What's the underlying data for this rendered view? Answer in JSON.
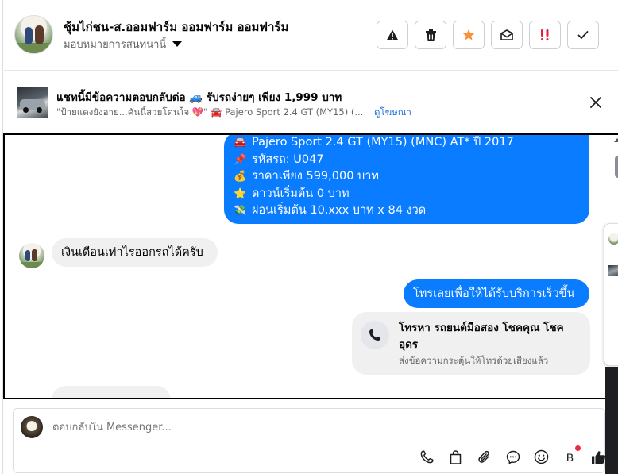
{
  "header": {
    "title": "ชุ้มไก่ชน-ส.ออมฟาร์ม ออมฟาร์ม ออมฟาร์ม",
    "assign_label": "มอบหมายการสนทนานี้",
    "buttons": [
      {
        "icon": "warning-icon"
      },
      {
        "icon": "trash-icon"
      },
      {
        "icon": "star-icon",
        "color": "#f7913d"
      },
      {
        "icon": "mark-unread-icon"
      },
      {
        "icon": "follow-up-icon",
        "color": "#e41e3f"
      },
      {
        "icon": "check-icon"
      }
    ]
  },
  "ad": {
    "title": "แชทนี้มีข้อความตอบกลับต่อ 🚙 รับรถง่ายๆ เพียง 1,999 บาท",
    "subtitle": "\"ป้ายแดงยังอาย...คันนี้สวยโดนใจ 💖\" 🚘 Pajero Sport 2.4 GT (MY15) (...",
    "link": "ดูโฆษณา"
  },
  "messages": {
    "car_info": [
      {
        "emoji": "🚘",
        "text": "Pajero Sport 2.4 GT (MY15) (MNC) AT* ปี 2017"
      },
      {
        "emoji": "📌",
        "text": "รหัสรถ: U047"
      },
      {
        "emoji": "💰",
        "text": "ราคาเพียง 599,000 บาท"
      },
      {
        "emoji": "⭐",
        "text": "ดาวน์เริ่มต้น 0 บาท"
      },
      {
        "emoji": "💸",
        "text": "ผ่อนเริ่มต้น 10,xxx บาท x 84 งวด"
      }
    ],
    "customer_msg": "เงินเดือนเท่าไรออกรถได้ครับ",
    "page_reply": "โทรเลยเพื่อให้ได้รับบริการเร็วขึ้น",
    "call_card": {
      "title": "โทรหา รถยนต์มือสอง โชคคุณ โชค อุดร",
      "subtitle": "ส่งข้อความกระตุ้นให้โทรด้วยเสียงแล้ว"
    }
  },
  "composer": {
    "placeholder": "ตอบกลับใน Messenger...",
    "tools": [
      "phone-icon",
      "shopping-bag-icon",
      "paperclip-icon",
      "saved-reply-icon",
      "emoji-icon",
      "payment-icon",
      "thumbs-up-icon"
    ],
    "payment_symbol": "฿"
  },
  "colors": {
    "accent": "#0a7cff",
    "bubble_grey": "#f0f0f0",
    "link": "#216fdb"
  }
}
